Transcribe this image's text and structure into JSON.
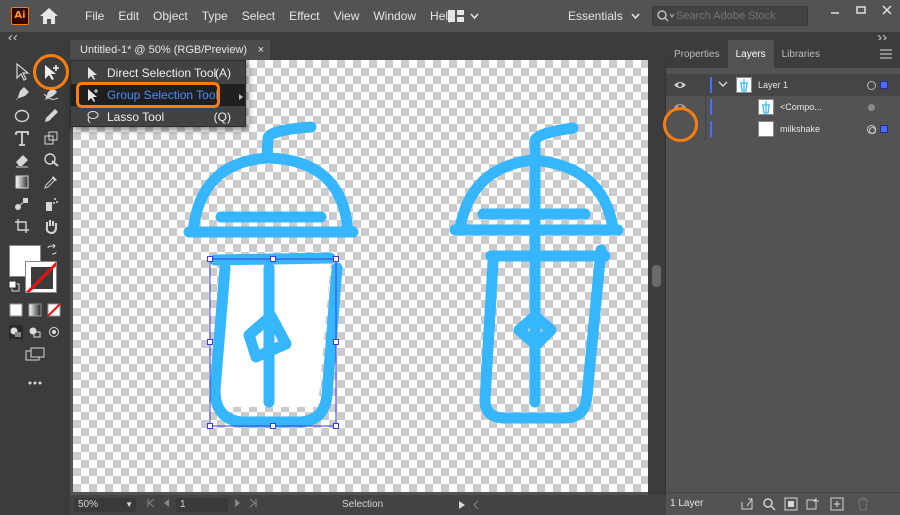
{
  "app": {
    "logo_text": "Ai",
    "menu": [
      "File",
      "Edit",
      "Object",
      "Type",
      "Select",
      "Effect",
      "View",
      "Window",
      "Help"
    ],
    "workspace": "Essentials",
    "search_placeholder": "Search Adobe Stock"
  },
  "document": {
    "tab_title": "Untitled-1* @ 50% (RGB/Preview)",
    "close_symbol": "×"
  },
  "flyout": {
    "items": [
      {
        "label": "Direct Selection Tool",
        "shortcut": "(A)"
      },
      {
        "label": "Group Selection Tool",
        "shortcut": ""
      },
      {
        "label": "Lasso Tool",
        "shortcut": "(Q)"
      }
    ]
  },
  "panel": {
    "tabs": [
      "Properties",
      "Layers",
      "Libraries"
    ],
    "active_tab": "Layers",
    "layers": [
      {
        "name": "Layer 1"
      },
      {
        "name": "<Compo..."
      },
      {
        "name": "milkshake"
      }
    ],
    "footer_count": "1 Layer"
  },
  "status": {
    "zoom": "50%",
    "artboard": "1",
    "current_tool": "Selection"
  },
  "icons": {
    "toolbar": [
      "selection-tool-icon",
      "group-selection-tool-icon",
      "pen-tool-icon",
      "curvature-tool-icon",
      "ellipse-tool-icon",
      "pencil-tool-icon",
      "type-tool-icon",
      "rotate-tool-icon",
      "eraser-tool-icon",
      "puppet-warp-tool-icon",
      "gradient-tool-icon",
      "eyedropper-tool-icon",
      "blend-tool-icon",
      "symbol-sprayer-tool-icon",
      "artboard-tool-icon",
      "hand-tool-icon",
      "fill-swatch-icon",
      "stroke-swatch-icon",
      "swap-colors-icon",
      "default-colors-icon",
      "color-mode-icon",
      "gradient-mode-icon",
      "none-mode-icon",
      "draw-normal-icon",
      "draw-behind-icon",
      "draw-inside-icon",
      "change-screen-mode-icon",
      "more-tools-icon"
    ]
  },
  "colors": {
    "accent_orange": "#ff7d0f",
    "artwork_blue": "#36b6ff",
    "highlight_blue": "#4c8eff"
  }
}
